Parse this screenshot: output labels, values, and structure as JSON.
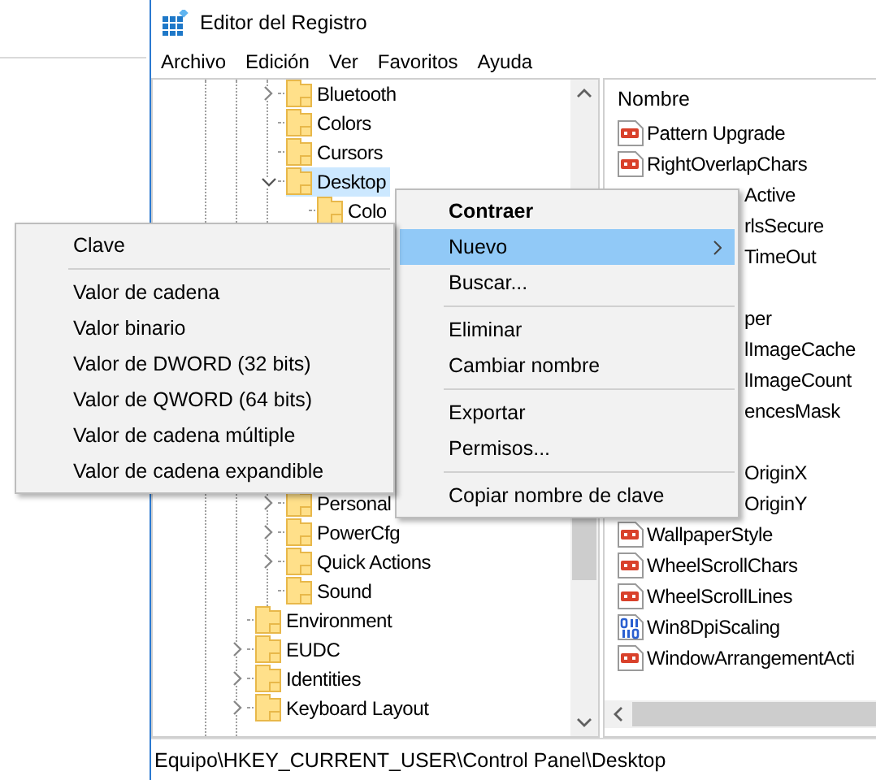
{
  "window": {
    "title": "Editor del Registro"
  },
  "menu_bar": [
    "Archivo",
    "Edición",
    "Ver",
    "Favoritos",
    "Ayuda"
  ],
  "tree": {
    "items": [
      {
        "children": [
          {
            "label": "Bluetooth",
            "expanded": false,
            "selected": false
          },
          {
            "label": "Colors",
            "selected": false
          },
          {
            "label": "Cursors",
            "selected": false
          },
          {
            "label": "Desktop",
            "expanded": true,
            "selected": true,
            "children": [
              {
                "label": "Colo",
                "selected": false
              }
            ]
          },
          {
            "label": "Personal",
            "expanded": false,
            "selected": false
          },
          {
            "label": "PowerCfg",
            "expanded": false,
            "selected": false
          },
          {
            "label": "Quick Actions",
            "expanded": false,
            "selected": false
          },
          {
            "label": "Sound",
            "selected": false
          }
        ]
      },
      {
        "label": "Environment",
        "selected": false
      },
      {
        "label": "EUDC",
        "expanded": false,
        "selected": false
      },
      {
        "label": "Identities",
        "expanded": false,
        "selected": false
      },
      {
        "label": "Keyboard Layout",
        "expanded": false,
        "selected": false
      }
    ]
  },
  "list": {
    "column": "Nombre",
    "rows": [
      {
        "kind": "string",
        "name": "Pattern Upgrade"
      },
      {
        "kind": "string",
        "name": "RightOverlapChars"
      },
      {
        "kind": "partial",
        "name": "Active"
      },
      {
        "kind": "partial",
        "name": "rlsSecure"
      },
      {
        "kind": "partial",
        "name": "TimeOut"
      },
      {
        "kind": "covered"
      },
      {
        "kind": "partial",
        "name": "per"
      },
      {
        "kind": "partial",
        "name": "lImageCache"
      },
      {
        "kind": "partial",
        "name": "lImageCount"
      },
      {
        "kind": "partial",
        "name": "encesMask"
      },
      {
        "kind": "covered"
      },
      {
        "kind": "partial",
        "name": "OriginX"
      },
      {
        "kind": "partial",
        "name": "OriginY"
      },
      {
        "kind": "string",
        "name": "WallpaperStyle"
      },
      {
        "kind": "string",
        "name": "WheelScrollChars"
      },
      {
        "kind": "string",
        "name": "WheelScrollLines"
      },
      {
        "kind": "binary",
        "name": "Win8DpiScaling"
      },
      {
        "kind": "string",
        "name": "WindowArrangementActi"
      }
    ]
  },
  "context_menu": {
    "items": [
      {
        "kind": "item",
        "label": "Contraer",
        "default": true,
        "selected": false
      },
      {
        "kind": "submenu",
        "label": "Nuevo",
        "selected": true
      },
      {
        "kind": "item",
        "label": "Buscar...",
        "selected": false
      },
      {
        "kind": "separator"
      },
      {
        "kind": "item",
        "label": "Eliminar",
        "selected": false
      },
      {
        "kind": "item",
        "label": "Cambiar nombre",
        "selected": false
      },
      {
        "kind": "separator"
      },
      {
        "kind": "item",
        "label": "Exportar",
        "selected": false
      },
      {
        "kind": "item",
        "label": "Permisos...",
        "selected": false
      },
      {
        "kind": "separator"
      },
      {
        "kind": "item",
        "label": "Copiar nombre de clave",
        "selected": false
      }
    ]
  },
  "submenu": {
    "items": [
      {
        "kind": "item",
        "label": "Clave",
        "selected": false
      },
      {
        "kind": "separator"
      },
      {
        "kind": "item",
        "label": "Valor de cadena",
        "selected": false
      },
      {
        "kind": "item",
        "label": "Valor binario",
        "selected": false
      },
      {
        "kind": "item",
        "label": "Valor de DWORD (32 bits)",
        "selected": false
      },
      {
        "kind": "item",
        "label": "Valor de QWORD (64 bits)",
        "selected": false
      },
      {
        "kind": "item",
        "label": "Valor de cadena múltiple",
        "selected": false
      },
      {
        "kind": "item",
        "label": "Valor de cadena expandible",
        "selected": false
      }
    ]
  },
  "status_bar": "Equipo\\HKEY_CURRENT_USER\\Control Panel\\Desktop"
}
